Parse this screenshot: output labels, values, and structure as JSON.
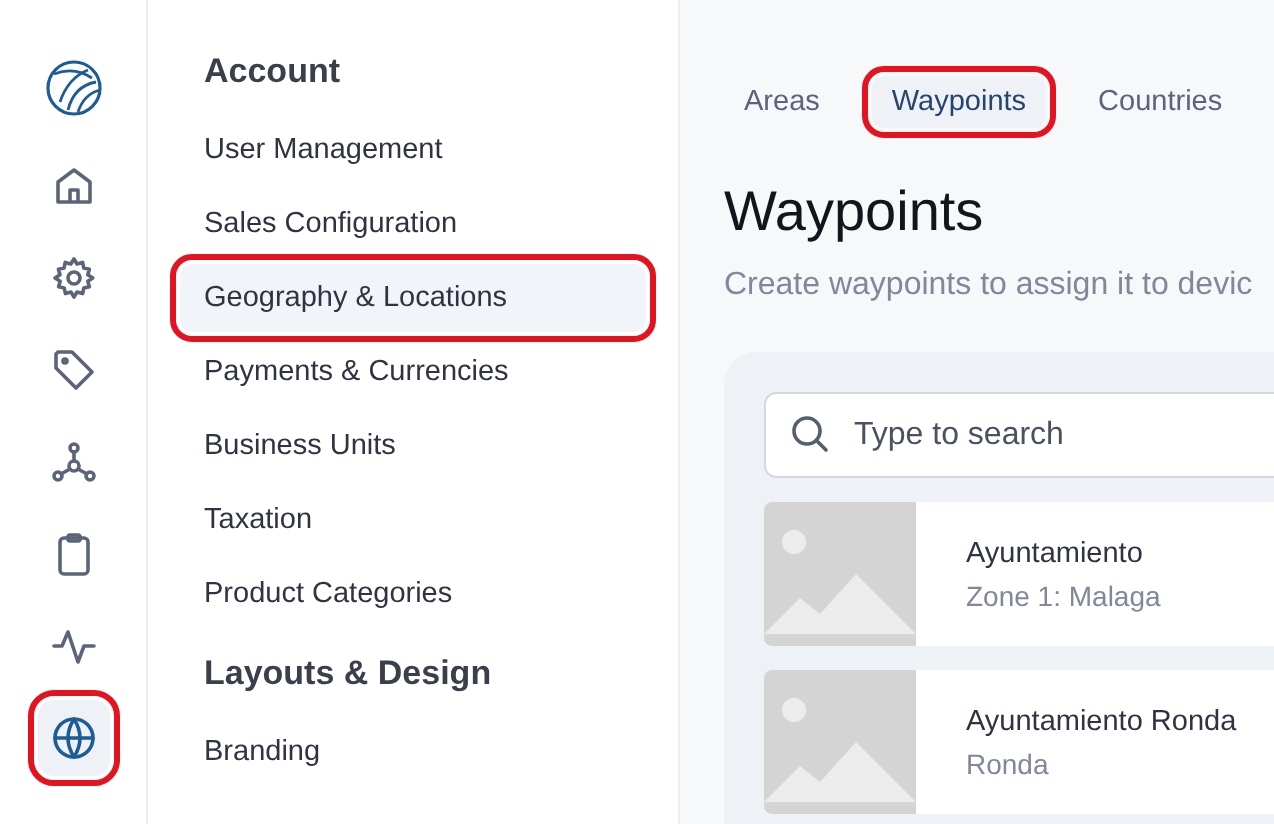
{
  "rail": {
    "items": [
      {
        "kind": "home",
        "selected": false,
        "highlighted": false
      },
      {
        "kind": "gear",
        "selected": false,
        "highlighted": false
      },
      {
        "kind": "tag",
        "selected": false,
        "highlighted": false
      },
      {
        "kind": "nodes",
        "selected": false,
        "highlighted": false
      },
      {
        "kind": "clipboard",
        "selected": false,
        "highlighted": false
      },
      {
        "kind": "activity",
        "selected": false,
        "highlighted": false
      },
      {
        "kind": "globe",
        "selected": true,
        "highlighted": true
      }
    ]
  },
  "settings_menu": {
    "sections": [
      {
        "heading": "Account",
        "items": [
          {
            "label": "User Management",
            "selected": false,
            "highlighted": false
          },
          {
            "label": "Sales Configuration",
            "selected": false,
            "highlighted": false
          },
          {
            "label": "Geography & Locations",
            "selected": true,
            "highlighted": true
          },
          {
            "label": "Payments & Currencies",
            "selected": false,
            "highlighted": false
          },
          {
            "label": "Business Units",
            "selected": false,
            "highlighted": false
          },
          {
            "label": "Taxation",
            "selected": false,
            "highlighted": false
          },
          {
            "label": "Product Categories",
            "selected": false,
            "highlighted": false
          }
        ]
      },
      {
        "heading": "Layouts & Design",
        "items": [
          {
            "label": "Branding",
            "selected": false,
            "highlighted": false
          }
        ]
      }
    ]
  },
  "tabs": [
    {
      "label": "Areas",
      "selected": false,
      "highlighted": false
    },
    {
      "label": "Waypoints",
      "selected": true,
      "highlighted": true
    },
    {
      "label": "Countries",
      "selected": false,
      "highlighted": false
    }
  ],
  "page": {
    "title": "Waypoints",
    "subtitle": "Create waypoints to assign it to devic"
  },
  "search": {
    "placeholder": "Type to search"
  },
  "waypoints": [
    {
      "name": "Ayuntamiento",
      "zone": "Zone 1: Malaga"
    },
    {
      "name": "Ayuntamiento Ronda",
      "zone": "Ronda"
    }
  ]
}
